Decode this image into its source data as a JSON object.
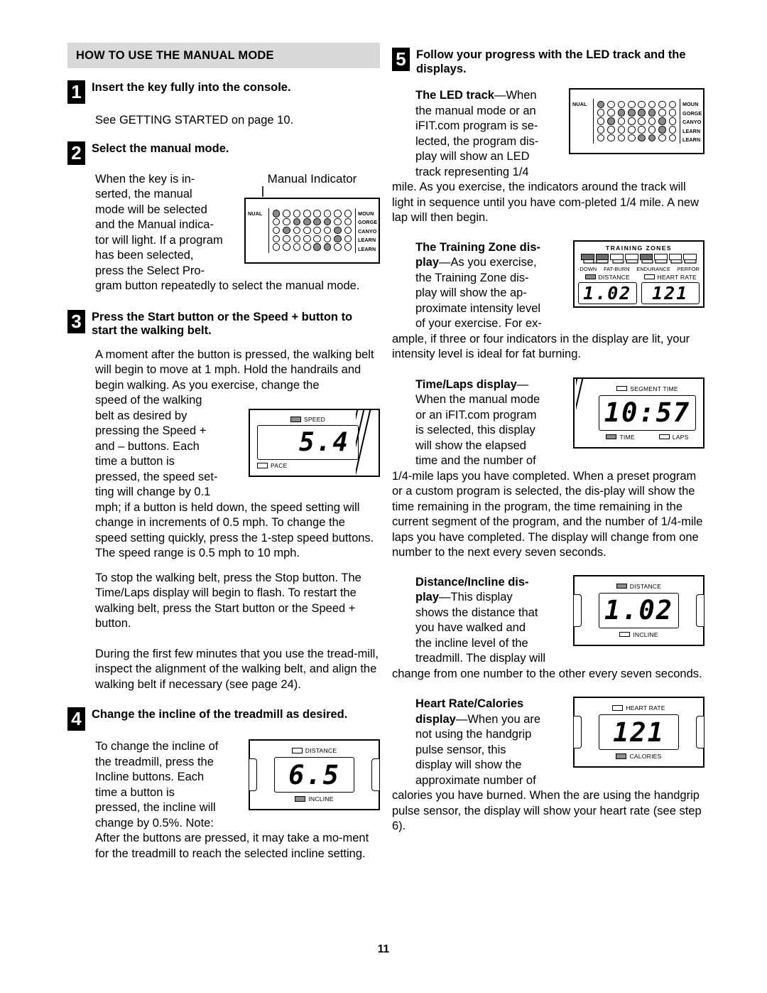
{
  "page": {
    "number": "11"
  },
  "left": {
    "section_header": "HOW TO USE THE MANUAL MODE",
    "step1": {
      "num": "1",
      "title": "Insert the key fully into the console.",
      "body": "See GETTING STARTED on page 10."
    },
    "step2": {
      "num": "2",
      "title": "Select the manual mode.",
      "body_wrap": "When the key is in-serted, the manual mode will be selected and the Manual indica-tor will light. If a program has been selected, press the Select Pro-",
      "body_wrap_lines": [
        "When the key is in-",
        "serted, the manual",
        "mode will be selected",
        "and the Manual indica-",
        "tor will light. If a program",
        "has been selected,",
        "press the Select Pro-"
      ],
      "body_full": "gram button repeatedly to select the manual mode.",
      "figure_caption": "Manual Indicator"
    },
    "step3": {
      "num": "3",
      "title": "Press the Start button or the Speed + button to start the walking belt.",
      "para1_full": "A moment after the button is pressed, the walking belt will begin to move at 1 mph. Hold the handrails and begin walking. As you exercise, change the",
      "para1_wrap_lines": [
        "speed of the walking",
        "belt as desired by",
        "pressing the Speed +",
        "and – buttons. Each",
        "time a button is",
        "pressed, the speed set-",
        "ting will change by 0.1"
      ],
      "para1_rest": "mph; if a button is held down, the speed setting will change in increments of 0.5 mph. To change the speed setting quickly, press the 1-step speed buttons. The speed range is 0.5 mph to 10 mph.",
      "para2": "To stop the walking belt, press the Stop button. The Time/Laps display will begin to flash. To restart the walking belt, press the Start button or the Speed + button.",
      "para3": "During the first few minutes that you use the tread-mill, inspect the alignment of the walking belt, and align the walking belt if necessary (see page 24)."
    },
    "step4": {
      "num": "4",
      "title": "Change the incline of the treadmill as desired.",
      "body_wrap_lines": [
        "To change the incline of",
        "the treadmill, press the",
        "Incline buttons. Each",
        "time a button is",
        "pressed, the incline will",
        "change by 0.5%. Note:"
      ],
      "body_rest": "After the buttons are pressed, it may take a mo-ment for the treadmill to reach the selected incline setting."
    }
  },
  "right": {
    "step5": {
      "num": "5",
      "title": "Follow your progress with the LED track and the displays."
    },
    "led_track": {
      "heading": "The LED track",
      "dash_text": "—When",
      "wrap_lines": [
        "the manual mode or an",
        "iFIT.com program is se-",
        "lected, the program dis-",
        "play will show an LED",
        "track representing 1/4"
      ],
      "rest": "mile. As you exercise, the indicators around the track will light in sequence until you have com-pleted 1/4 mile. A new lap will then begin."
    },
    "training_zone": {
      "heading_line1": "The Training Zone dis-",
      "heading_line2": "play",
      "dash_text": "—As you exercise,",
      "wrap_lines": [
        "the Training Zone dis-",
        "play will show the ap-",
        "proximate intensity level",
        "of your exercise. For ex-"
      ],
      "rest": "ample, if three or four indicators in the display are lit, your intensity level is ideal for fat burning."
    },
    "time_laps": {
      "heading": "Time/Laps display",
      "dash_text": "—",
      "wrap_lines": [
        "When the manual mode",
        "or an iFIT.com program",
        "is selected, this display",
        "will show the elapsed",
        "time and the number of"
      ],
      "rest": "1/4-mile laps you have completed. When a preset program or a custom program is selected, the dis-play will show the time remaining in the program, the time remaining in the current segment of the program, and the number of 1/4-mile laps you have completed. The display will change from one number to the next every seven seconds."
    },
    "distance_incline": {
      "heading_line1": "Distance/Incline dis-",
      "heading_line2": "play",
      "dash_text": "—This display",
      "wrap_lines": [
        "shows the distance that",
        "you have walked and",
        "the incline level of the",
        "treadmill. The display will"
      ],
      "rest": "change from one number to the other every seven seconds."
    },
    "heart_rate": {
      "heading_line1": "Heart Rate/Calories",
      "heading_line2": "display",
      "dash_text": "—When you are",
      "wrap_lines": [
        "not using the handgrip",
        "pulse sensor, this",
        "display will show the",
        "approximate number of"
      ],
      "rest": "calories you have burned. When the are using the handgrip pulse sensor, the display will show your heart rate (see step 6)."
    }
  },
  "figures": {
    "led_matrix": {
      "left_labels": [
        "NUAL",
        "",
        "",
        "",
        ""
      ],
      "right_labels": [
        "MOUN",
        "GORGE",
        "CANYO",
        "LEARN",
        "LEARN"
      ],
      "rows": 5,
      "cols": 8,
      "lit": [
        [
          1,
          0,
          0,
          0,
          0,
          0,
          0,
          0
        ],
        [
          0,
          0,
          1,
          1,
          1,
          1,
          0,
          0
        ],
        [
          0,
          1,
          0,
          0,
          0,
          0,
          1,
          0
        ],
        [
          0,
          0,
          0,
          0,
          0,
          0,
          1,
          0
        ],
        [
          0,
          0,
          0,
          0,
          1,
          1,
          0,
          0
        ]
      ]
    },
    "speed_display": {
      "top_label": "SPEED",
      "top_lit": true,
      "value": "5.4",
      "bottom_label": "PACE",
      "bottom_lit": false
    },
    "incline_display": {
      "top_label": "DISTANCE",
      "top_lit": false,
      "value": "6.5",
      "bottom_label": "INCLINE",
      "bottom_lit": true
    },
    "training_zones": {
      "title": "TRAINING ZONES",
      "bars": [
        1,
        1,
        0,
        0,
        1,
        0,
        0,
        0
      ],
      "labels": [
        "-DOWN",
        "FAT-BURN",
        "ENDURANCE",
        "PERFOR"
      ],
      "left_readout": {
        "label": "DISTANCE",
        "lit": true,
        "value": "1.02"
      },
      "right_readout": {
        "label": "HEART RATE",
        "lit": false,
        "value": "121"
      }
    },
    "time_display": {
      "top_label": "SEGMENT TIME",
      "top_lit": false,
      "value": "10:57",
      "bottom_labels": [
        {
          "label": "TIME",
          "lit": true
        },
        {
          "label": "LAPS",
          "lit": false
        }
      ]
    },
    "distance_display": {
      "top_label": "DISTANCE",
      "top_lit": true,
      "value": "1.02",
      "bottom_label": "INCLINE",
      "bottom_lit": false
    },
    "heart_display": {
      "top_label": "HEART RATE",
      "top_lit": false,
      "value": "121",
      "bottom_label": "CALORIES",
      "bottom_lit": true
    }
  }
}
